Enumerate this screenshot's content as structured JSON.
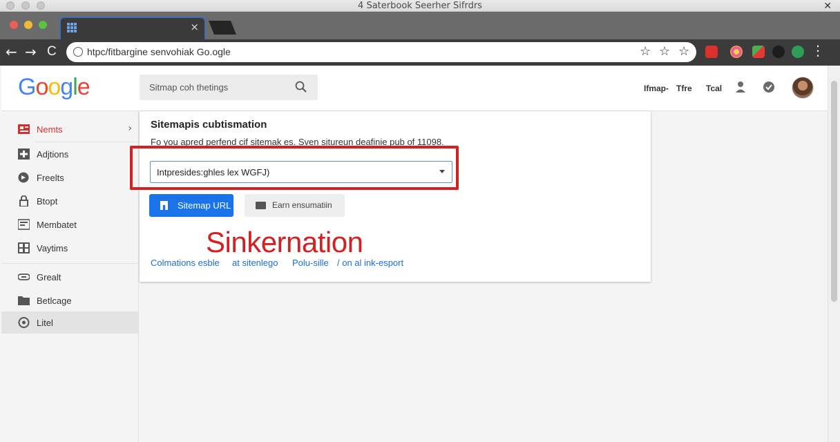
{
  "os": {
    "title": "4 Saterbook Seerher Sifrdrs"
  },
  "tab": {
    "close_glyph": "×"
  },
  "toolbar": {
    "back": "←",
    "forward": "→",
    "reload": "C",
    "url": "htpc/fitbargine senvohiak Go.ogle",
    "menu": "⋮"
  },
  "header": {
    "logo_letters": [
      {
        "ch": "G",
        "color": "#4285f4"
      },
      {
        "ch": "o",
        "color": "#ea4335"
      },
      {
        "ch": "o",
        "color": "#fbbc05"
      },
      {
        "ch": "g",
        "color": "#4285f4"
      },
      {
        "ch": "l",
        "color": "#34a853"
      },
      {
        "ch": "e",
        "color": "#ea4335"
      }
    ],
    "search_placeholder": "Sitmap coh thetings",
    "links": [
      "Ifmap-",
      "Tfre",
      "Tcal"
    ]
  },
  "sidebar": {
    "items": [
      {
        "label": "Nemts",
        "icon": "news-icon"
      },
      {
        "label": "Adjtions",
        "icon": "add-icon"
      },
      {
        "label": "Freelts",
        "icon": "feed-icon"
      },
      {
        "label": "Btopt",
        "icon": "lock-icon"
      },
      {
        "label": "Membatet",
        "icon": "keyboard-icon"
      },
      {
        "label": "Vaytims",
        "icon": "grid-icon"
      },
      {
        "label": "Grealt",
        "icon": "link-icon"
      },
      {
        "label": "Betlcage",
        "icon": "folder-icon"
      },
      {
        "label": "Litel",
        "icon": "settings-icon"
      }
    ]
  },
  "card": {
    "title": "Sitemapis cubtismation",
    "description": "Fo you apred perfend cif sitemak es. Sven situreun deafinie pub of 11098.",
    "select_value": "Intpresides:ghles lex WGFJ)",
    "primary_button": "Sitemap URL",
    "secondary_button": "Earn ensumatiin",
    "overlay": "Sinkernation",
    "links": [
      "Colmations esble",
      "at sitenlego",
      "Polu-sille",
      "/ on al ink-esport"
    ]
  },
  "colors": {
    "accent": "#1a73e8",
    "highlight": "#d42020",
    "active_item": "#d32f2f"
  }
}
